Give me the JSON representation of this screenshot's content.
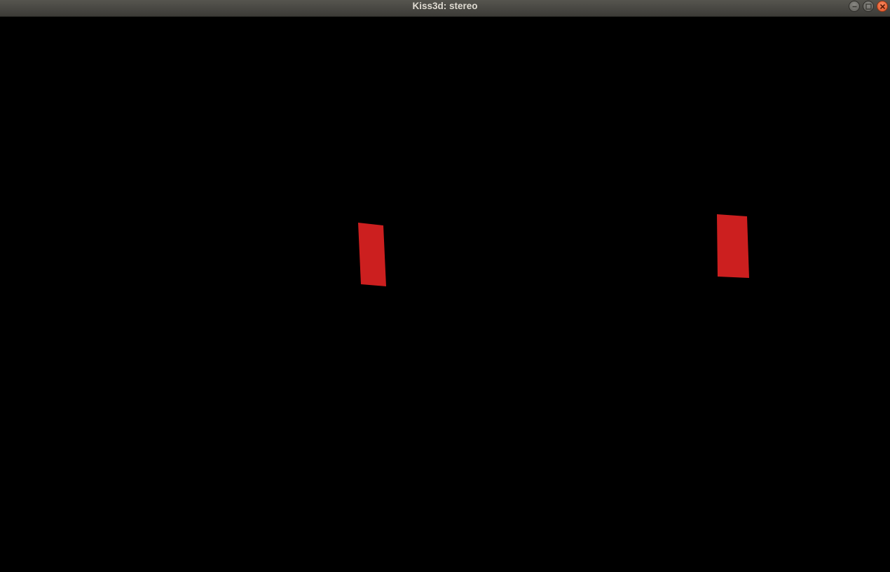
{
  "window": {
    "title": "Kiss3d: stereo",
    "controls": {
      "minimize_icon": "minimize-icon",
      "maximize_icon": "maximize-icon",
      "close_icon": "close-icon"
    }
  },
  "scene": {
    "background_color": "#000000",
    "object_color": "#cc1f1f",
    "views": [
      "left-eye",
      "right-eye"
    ]
  }
}
